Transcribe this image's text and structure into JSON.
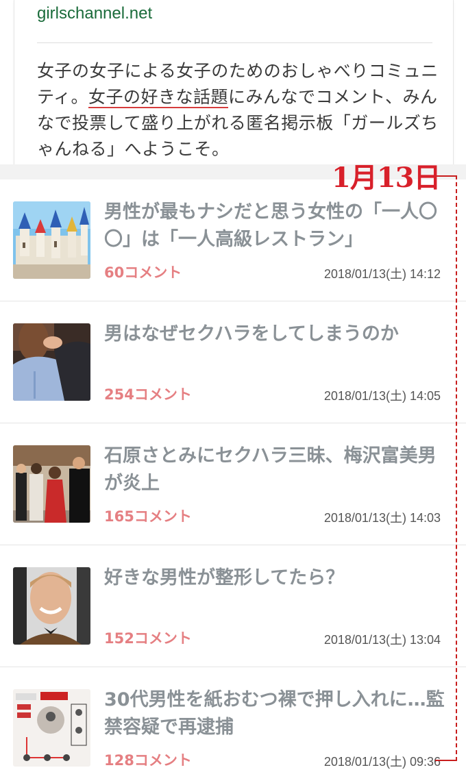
{
  "site": {
    "url": "girlschannel.net",
    "desc_pre": "女子の女子による女子のためのおしゃべりコミュニティ。",
    "desc_highlight": "女子の好きな話題",
    "desc_post": "にみんなでコメント、みんなで投票して盛り上がれる匿名掲示板「ガールズちゃんねる」へようこそ。"
  },
  "annotation": {
    "date": "1月13日"
  },
  "topics": [
    {
      "title": "男性が最もナシだと思う女性の「一人〇〇」は「一人高級レストラン」",
      "comments": "60コメント",
      "date": "2018/01/13(土) 14:12"
    },
    {
      "title": "男はなぜセクハラをしてしまうのか",
      "comments": "254コメント",
      "date": "2018/01/13(土) 14:05"
    },
    {
      "title": "石原さとみにセクハラ三昧、梅沢富美男が炎上",
      "comments": "165コメント",
      "date": "2018/01/13(土) 14:03"
    },
    {
      "title": "好きな男性が整形してたら？",
      "comments": "152コメント",
      "date": "2018/01/13(土) 13:04"
    },
    {
      "title": "30代男性を紙おむつ裸で押し入れに…監禁容疑で再逮捕",
      "comments": "128コメント",
      "date": "2018/01/13(土) 09:36"
    }
  ]
}
